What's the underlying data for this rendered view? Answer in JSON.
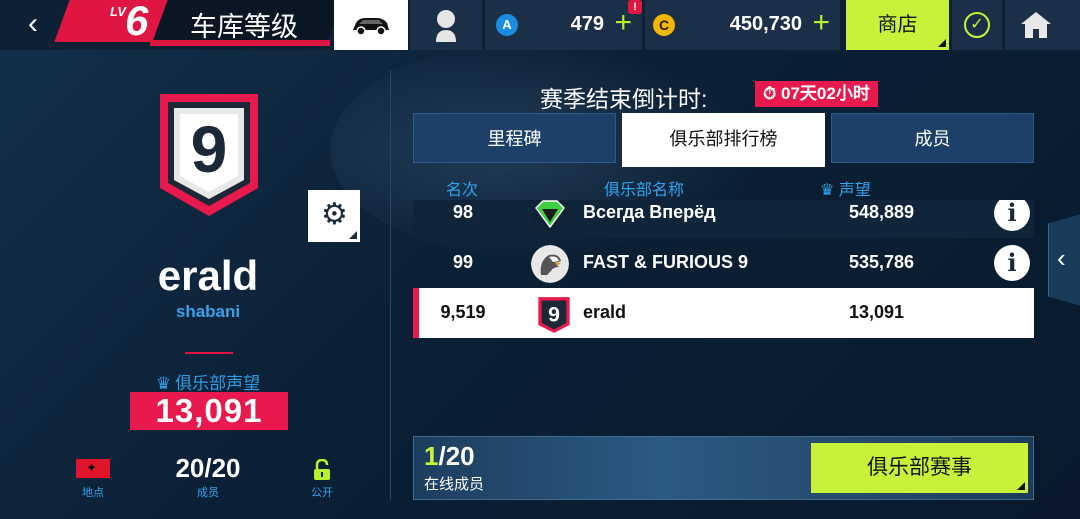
{
  "topbar": {
    "back_icon": "‹",
    "level_prefix": "LV",
    "level": "6",
    "title": "车库等级",
    "gems": "479",
    "gems_plus": "+",
    "notification": "!",
    "coins": "450,730",
    "coins_plus": "+",
    "shop": "商店",
    "check_icon": "✓"
  },
  "profile": {
    "badge_number": "9",
    "name": "erald",
    "sub": "shabani",
    "reputation_label": "俱乐部声望",
    "reputation_value": "13,091",
    "location_label": "地点",
    "members_value": "20/20",
    "members_label": "成员",
    "public_label": "公开"
  },
  "season": {
    "label": "赛季结束倒计时:",
    "timer_icon": "⏱",
    "timer": "07天02小时"
  },
  "tabs": [
    {
      "label": "里程碑"
    },
    {
      "label": "俱乐部排行榜"
    },
    {
      "label": "成员"
    }
  ],
  "columns": {
    "rank": "名次",
    "club": "俱乐部名称",
    "rep_icon": "♛",
    "rep": "声望"
  },
  "rows": [
    {
      "rank": "98",
      "name": "Всегда Вперёд",
      "rep": "548,889"
    },
    {
      "rank": "99",
      "name": "FAST & FURIOUS 9",
      "rep": "535,786"
    },
    {
      "rank": "9,519",
      "name": "erald",
      "rep": "13,091"
    }
  ],
  "online": {
    "current": "1",
    "total": "/20",
    "label": "在线成员",
    "event_button": "俱乐部赛事"
  },
  "colors": {
    "accent_red": "#e8194c",
    "accent_lime": "#c8f23a",
    "accent_blue": "#2ea4ee"
  }
}
